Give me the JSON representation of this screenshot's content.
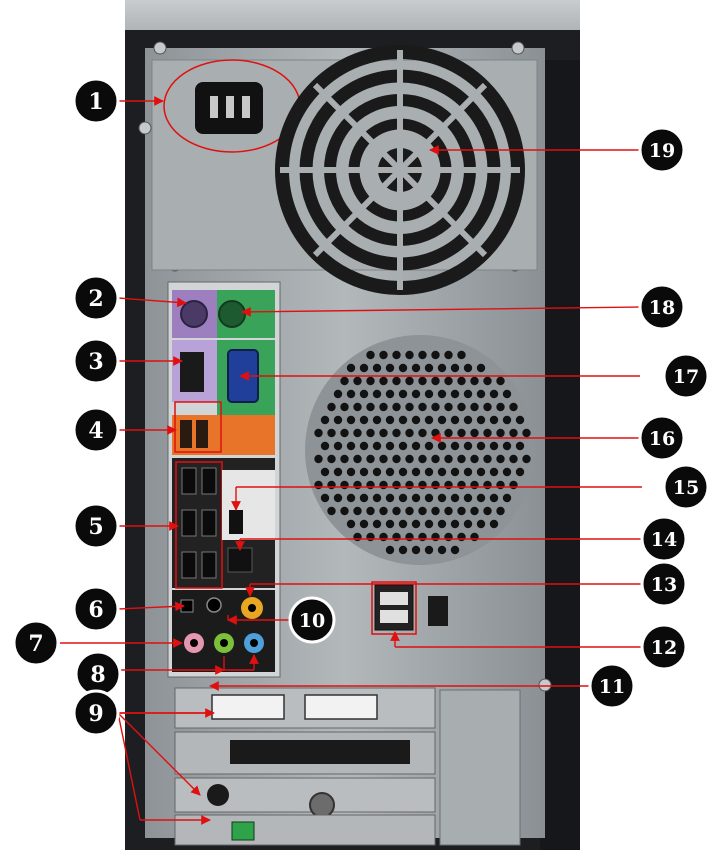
{
  "colors": {
    "callout_fill": "#0a0a0a",
    "callout_ring": "#ffffff",
    "leader_line": "#e01010",
    "chassis": "#9ea4a8",
    "case_dark": "#1c1e22",
    "ps2_keyboard": "#9d7fc0",
    "ps2_mouse": "#3aa35a",
    "firewire_panel": "#e8742a",
    "audio_line_out": "#7bbf3a",
    "audio_mic": "#e596b0",
    "audio_line_in": "#4fa0d8",
    "audio_spdif": "#e7a623"
  },
  "callouts": [
    {
      "id": "1",
      "label": "1"
    },
    {
      "id": "2",
      "label": "2"
    },
    {
      "id": "3",
      "label": "3"
    },
    {
      "id": "4",
      "label": "4"
    },
    {
      "id": "5",
      "label": "5"
    },
    {
      "id": "6",
      "label": "6"
    },
    {
      "id": "7",
      "label": "7"
    },
    {
      "id": "8",
      "label": "8"
    },
    {
      "id": "9",
      "label": "9"
    },
    {
      "id": "10",
      "label": "10"
    },
    {
      "id": "11",
      "label": "11"
    },
    {
      "id": "12",
      "label": "12"
    },
    {
      "id": "13",
      "label": "13"
    },
    {
      "id": "14",
      "label": "14"
    },
    {
      "id": "15",
      "label": "15"
    },
    {
      "id": "16",
      "label": "16"
    },
    {
      "id": "17",
      "label": "17"
    },
    {
      "id": "18",
      "label": "18"
    },
    {
      "id": "19",
      "label": "19"
    }
  ]
}
